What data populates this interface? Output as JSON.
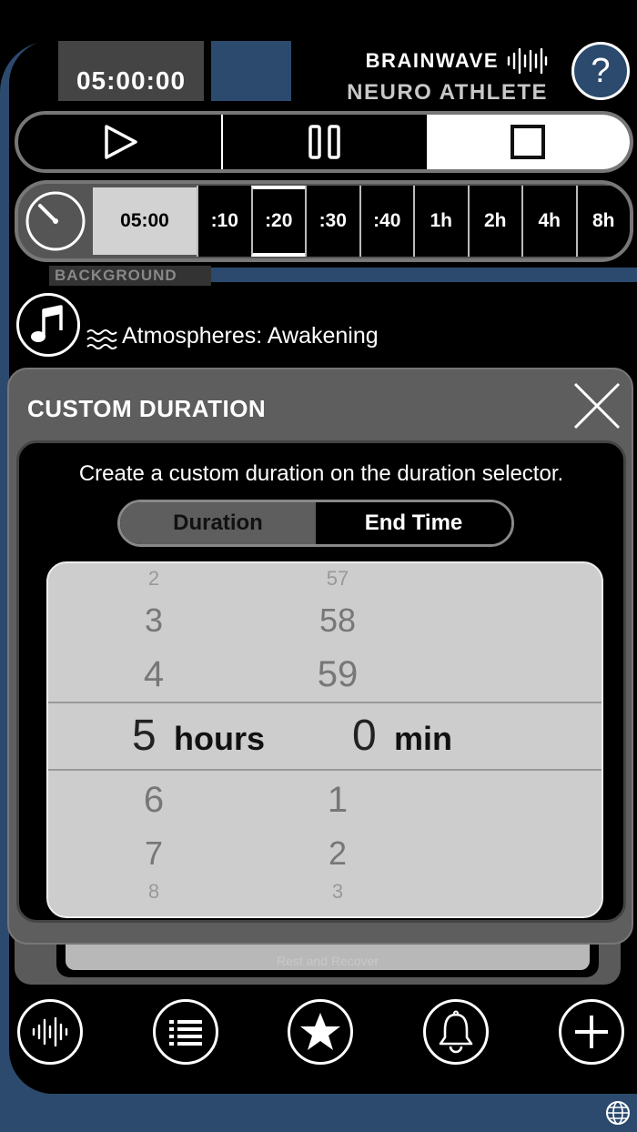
{
  "header": {
    "timer": "05:00:00",
    "brand_line1": "BRAINWAVE",
    "brand_line2": "NEURO ATHLETE",
    "help_label": "?"
  },
  "transport": {
    "buttons": [
      "play",
      "pause",
      "stop"
    ],
    "active": "stop"
  },
  "duration_selector": {
    "current": "05:00",
    "chips": [
      ":10",
      ":20",
      ":30",
      ":40",
      "1h",
      "2h",
      "4h",
      "8h"
    ],
    "selected": ":20"
  },
  "background": {
    "section_label": "BACKGROUND",
    "track_label": "Atmospheres: Awakening"
  },
  "hidden_card_label": "Rest and Recover",
  "modal": {
    "title": "CUSTOM DURATION",
    "description": "Create a custom duration on the duration selector.",
    "segments": [
      "Duration",
      "End Time"
    ],
    "active_segment": "End Time",
    "picker": {
      "hours_above": [
        "2",
        "3",
        "4"
      ],
      "hours_selected": "5",
      "hours_unit": "hours",
      "hours_below": [
        "6",
        "7",
        "8"
      ],
      "minutes_above": [
        "57",
        "58",
        "59"
      ],
      "minutes_selected": "0",
      "minutes_unit": "min",
      "minutes_below": [
        "1",
        "2",
        "3"
      ]
    }
  },
  "bottom_nav": [
    "waveform-icon",
    "list-icon",
    "star-icon",
    "bell-icon",
    "plus-icon"
  ],
  "colors": {
    "accent_blue": "#2c4a6e",
    "panel_gray": "#5e5e5e",
    "picker_bg": "#cdcdcd"
  }
}
